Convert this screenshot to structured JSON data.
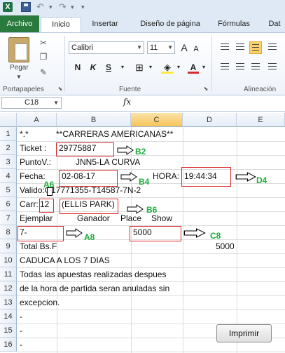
{
  "qat": {
    "app_letter": "X",
    "undo": "↶",
    "redo": "↷"
  },
  "tabs": [
    "Archivo",
    "Inicio",
    "Insertar",
    "Diseño de página",
    "Fórmulas",
    "Dat"
  ],
  "ribbon": {
    "clipboard_label": "Portapapeles",
    "paste_label": "Pegar",
    "font_label": "Fuente",
    "alignment_label": "Alineación",
    "font_name": "Calibri",
    "font_size": "11",
    "bold": "N",
    "italic": "K",
    "underline": "S",
    "grow_font": "A",
    "shrink_font": "A",
    "font_color_letter": "A"
  },
  "formula_bar": {
    "name_box": "C18",
    "fx": "fx",
    "formula": ""
  },
  "columns": [
    "A",
    "B",
    "C",
    "D",
    "E"
  ],
  "rows": [
    "1",
    "2",
    "3",
    "4",
    "5",
    "6",
    "7",
    "8",
    "9",
    "10",
    "11",
    "12",
    "13",
    "14",
    "15",
    "16"
  ],
  "cells": {
    "r1a": "*.*",
    "r1b": "**CARRERAS AMERICANAS**",
    "r2a": "Ticket :",
    "r2b": "29775887",
    "r3a": "PuntoV.:",
    "r3b": "JNN5-LA CURVA",
    "r4a": "Fecha:",
    "r4b": "02-08-17",
    "r4c": "HORA:",
    "r4d": "19:44:34",
    "r5a": "Valido:G17771355-T14587-7N-2",
    "r6a": "Carr:",
    "r6a2": "12",
    "r6b": "(ELLIS PARK)",
    "r7a": "Ejemplar",
    "r7b": "Ganador",
    "r7c1": "Place",
    "r7c2": "Show",
    "r8a": "7-",
    "r8c": "5000",
    "r9a": "Total Bs.F",
    "r9d": "5000",
    "r10a": "CADUCA A LOS 7 DIAS",
    "r11a": "Todas las apuestas realizadas despues",
    "r12a": "de la hora de partida seran anuladas sin",
    "r13a": "excepcion.",
    "r14a": "-",
    "r15a": "-",
    "r16a": "-"
  },
  "annotations": {
    "b2": "B2",
    "b4": "B4",
    "d4": "D4",
    "a6": "A6",
    "b6": "B6",
    "a8": "A8",
    "c8": "C8"
  },
  "button": {
    "print": "Imprimir"
  },
  "colors": {
    "red_box": "#d92a2a",
    "annotation_green": "#1eae3b",
    "file_tab": "#2a7a3e"
  }
}
